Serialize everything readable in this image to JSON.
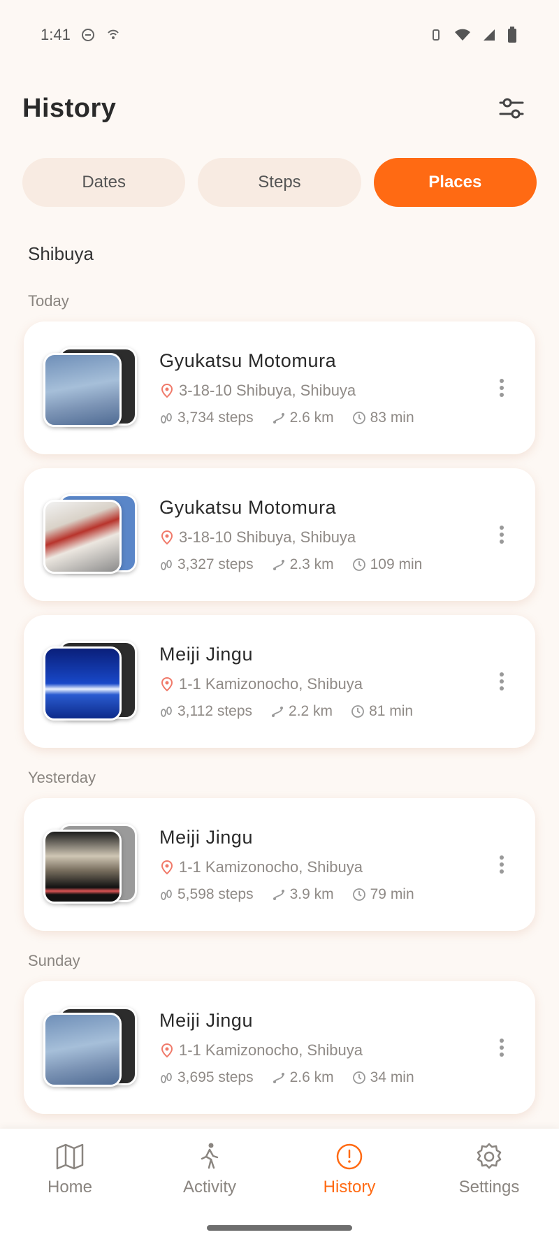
{
  "status_bar": {
    "time": "1:41"
  },
  "header": {
    "title": "History"
  },
  "tabs": [
    {
      "label": "Dates",
      "active": false
    },
    {
      "label": "Steps",
      "active": false
    },
    {
      "label": "Places",
      "active": true
    }
  ],
  "location": {
    "title": "Shibuya"
  },
  "sections": [
    {
      "label": "Today",
      "entries": [
        {
          "name": "Gyukatsu Motomura",
          "address": "3-18-10 Shibuya, Shibuya",
          "steps": "3,734 steps",
          "distance": "2.6 km",
          "duration": "83 min",
          "thumb": "sky"
        },
        {
          "name": "Gyukatsu Motomura",
          "address": "3-18-10 Shibuya, Shibuya",
          "steps": "3,327 steps",
          "distance": "2.3 km",
          "duration": "109 min",
          "thumb": "restaurant"
        },
        {
          "name": "Meiji Jingu",
          "address": "1-1 Kamizonocho, Shibuya",
          "steps": "3,112 steps",
          "distance": "2.2 km",
          "duration": "81 min",
          "thumb": "deepsky"
        }
      ]
    },
    {
      "label": "Yesterday",
      "entries": [
        {
          "name": "Meiji Jingu",
          "address": "1-1 Kamizonocho, Shibuya",
          "steps": "5,598 steps",
          "distance": "3.9 km",
          "duration": "79 min",
          "thumb": "indoor"
        }
      ]
    },
    {
      "label": "Sunday",
      "entries": [
        {
          "name": "Meiji Jingu",
          "address": "1-1 Kamizonocho, Shibuya",
          "steps": "3,695 steps",
          "distance": "2.6 km",
          "duration": "34 min",
          "thumb": "sky"
        }
      ]
    }
  ],
  "bottom_nav": [
    {
      "label": "Home",
      "icon": "map-icon",
      "active": false
    },
    {
      "label": "Activity",
      "icon": "walking-icon",
      "active": false
    },
    {
      "label": "History",
      "icon": "history-icon",
      "active": true
    },
    {
      "label": "Settings",
      "icon": "gear-icon",
      "active": false
    }
  ],
  "colors": {
    "accent": "#ff6a13",
    "background": "#fdf8f4",
    "tab_inactive": "#f8ebe2"
  }
}
